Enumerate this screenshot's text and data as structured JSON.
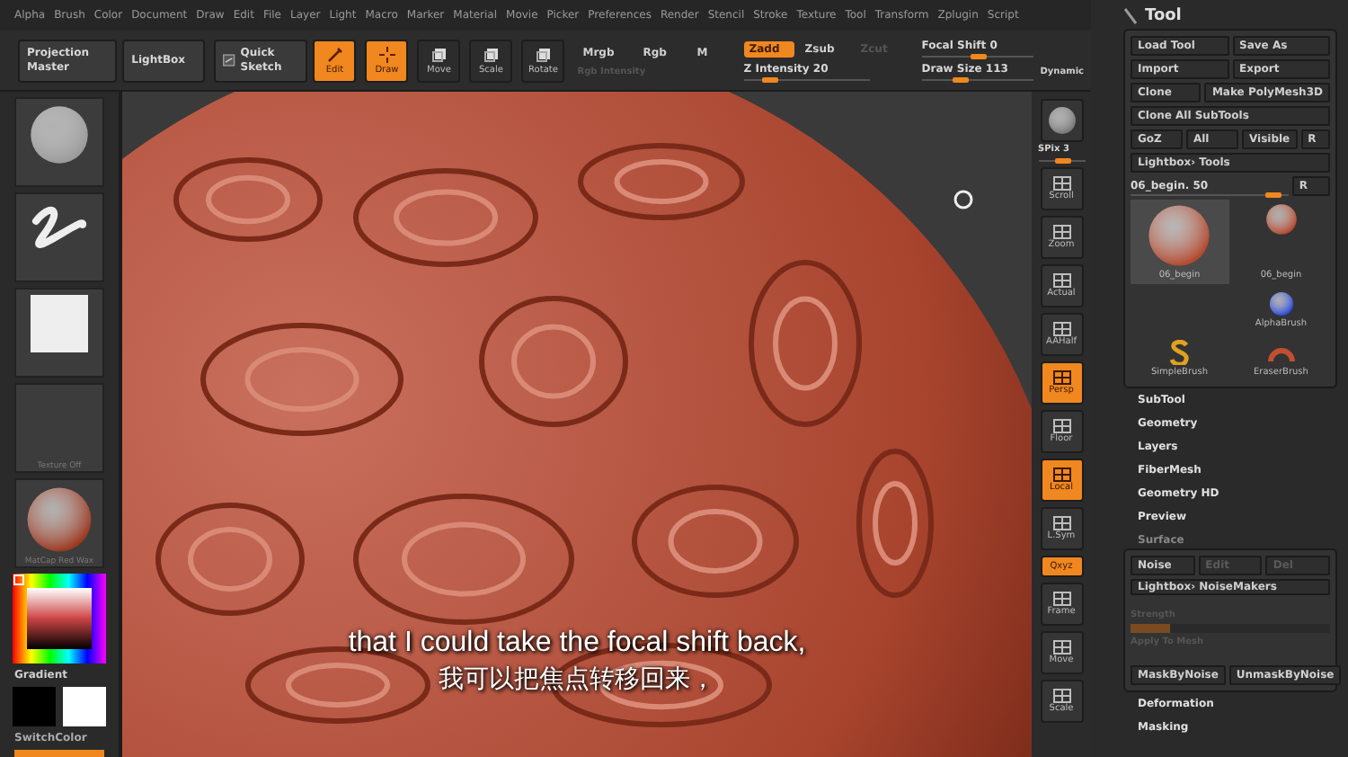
{
  "menu_bar": {
    "items": [
      "Alpha",
      "Brush",
      "Color",
      "Document",
      "Draw",
      "Edit",
      "File",
      "Layer",
      "Light",
      "Macro",
      "Marker",
      "Material",
      "Movie",
      "Picker",
      "Preferences",
      "Render",
      "Stencil",
      "Stroke",
      "Texture",
      "Tool",
      "Transform",
      "Zplugin",
      "Script"
    ]
  },
  "shelf": {
    "wide_buttons": [
      "Projection Master",
      "LightBox"
    ],
    "quick_sketch": "Quick Sketch",
    "tools": [
      {
        "label": "Edit",
        "selected": true
      },
      {
        "label": "Draw",
        "selected": true
      },
      {
        "label": "Move",
        "selected": false
      },
      {
        "label": "Scale",
        "selected": false
      },
      {
        "label": "Rotate",
        "selected": false
      }
    ],
    "channels": [
      {
        "label": "Mrgb",
        "selected": false
      },
      {
        "label": "Rgb",
        "selected": false
      },
      {
        "label": "M",
        "selected": false
      }
    ],
    "rgb_intensity": {
      "label": "Rgb Intensity",
      "disabled": true
    },
    "z_modes": [
      {
        "label": "Zadd",
        "selected": true,
        "disabled": false
      },
      {
        "label": "Zsub",
        "selected": false,
        "disabled": false
      },
      {
        "label": "Zcut",
        "selected": false,
        "disabled": true
      }
    ],
    "z_intensity": {
      "label": "Z Intensity 20",
      "level": 0.2
    },
    "focal_shift": {
      "label": "Focal Shift 0",
      "level": 0.5
    },
    "draw_size": {
      "label": "Draw Size 113",
      "level": 0.35
    },
    "dynamic": "Dynamic"
  },
  "left_tray": {
    "thumbnails": [
      {
        "kind": "brush"
      },
      {
        "kind": "stroke"
      },
      {
        "kind": "alpha"
      },
      {
        "kind": "texture",
        "label": "Texture Off"
      },
      {
        "kind": "material",
        "label": "MatCap Red Wax"
      }
    ],
    "gradient_label": "Gradient",
    "swatches": [
      {
        "color": "#000000"
      },
      {
        "color": "#ffffff"
      }
    ],
    "switch_color": "SwitchColor"
  },
  "viewport": {
    "subtitles": [
      "that I could take the focal shift back,",
      "我可以把焦点转移回来，"
    ]
  },
  "right_shelf": [
    {
      "label": "SPix 3",
      "kind": "slider",
      "level": 0.5
    },
    {
      "label": "Scroll",
      "kind": "button",
      "selected": false
    },
    {
      "label": "Zoom",
      "kind": "button",
      "selected": false
    },
    {
      "label": "Actual",
      "kind": "button",
      "selected": false
    },
    {
      "label": "AAHalf",
      "kind": "button",
      "selected": false
    },
    {
      "label": "Persp",
      "kind": "button",
      "selected": true
    },
    {
      "label": "Floor",
      "kind": "button",
      "selected": false
    },
    {
      "label": "Local",
      "kind": "button",
      "selected": true
    },
    {
      "label": "L.Sym",
      "kind": "button",
      "selected": false
    },
    {
      "label": "Qxyz",
      "kind": "small",
      "selected": true
    },
    {
      "label": "Frame",
      "kind": "button",
      "selected": false
    },
    {
      "label": "Move",
      "kind": "button",
      "selected": false
    },
    {
      "label": "Scale",
      "kind": "button",
      "selected": false
    }
  ],
  "tool_panel": {
    "title": "Tool",
    "button_rows": [
      [
        "Load Tool",
        "Save As"
      ],
      [
        "Import",
        "Export"
      ],
      [
        "Clone",
        "Make PolyMesh3D"
      ],
      [
        "Clone All SubTools"
      ],
      [
        "GoZ",
        "All",
        "Visible",
        "R"
      ],
      [
        "Lightbox› Tools"
      ]
    ],
    "tool_slider": {
      "label": "06_begin. 50",
      "level": 0.9,
      "button": "R"
    },
    "tools": [
      {
        "label": "06_begin",
        "kind": "large"
      },
      {
        "label": "06_begin",
        "kind": "small"
      },
      {
        "label": "AlphaBrush",
        "kind": "alpha"
      },
      {
        "label": "SimpleBrush",
        "kind": "simple"
      },
      {
        "label": "EraserBrush",
        "kind": "eraser"
      }
    ],
    "sections": [
      "SubTool",
      "Geometry",
      "Layers",
      "FiberMesh",
      "Geometry HD",
      "Preview"
    ],
    "surface": {
      "title": "Surface",
      "tabs": [
        {
          "label": "Noise",
          "disabled": false
        },
        {
          "label": "Edit",
          "disabled": true
        },
        {
          "label": "Del",
          "disabled": true
        }
      ],
      "lightbox": "Lightbox› NoiseMakers",
      "strength": {
        "label": "Strength",
        "disabled": true,
        "level": 0.2
      },
      "apply": {
        "label": "Apply To Mesh",
        "disabled": true
      },
      "mask_buttons": [
        "MaskByNoise",
        "UnmaskByNoise"
      ]
    },
    "lower_sections": [
      "Deformation",
      "Masking"
    ]
  }
}
